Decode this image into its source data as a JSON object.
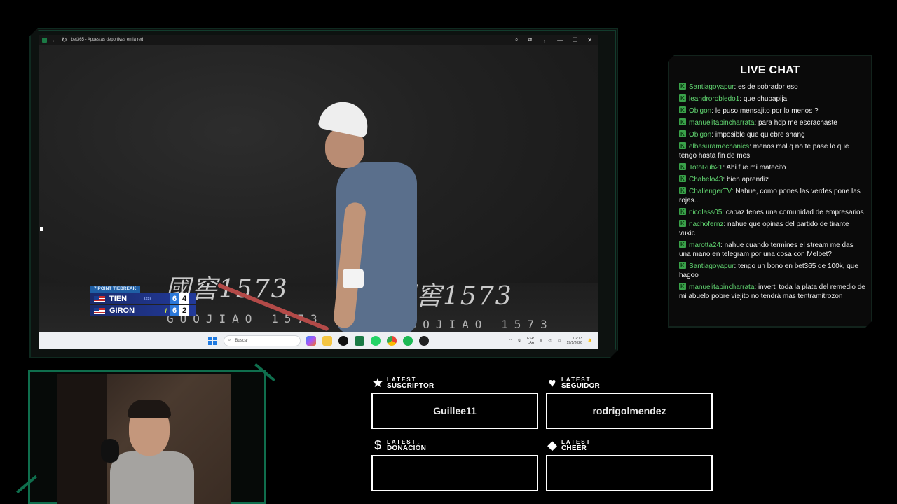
{
  "browser": {
    "title": "bet365 - Apuestas deportivas en la red"
  },
  "video": {
    "sponsor_text": "1573",
    "sponsor_prefix": "國窖",
    "sponsor_sub": "GUOJIAO 1573",
    "scoreboard": {
      "header": "7 POINT TIEBREAK",
      "players": [
        {
          "name": "TIEN",
          "rank": "(25)",
          "set": "6",
          "game": "4",
          "serving": ""
        },
        {
          "name": "GIRON",
          "rank": "",
          "set": "6",
          "game": "2",
          "serving": "/"
        }
      ]
    }
  },
  "taskbar": {
    "search_placeholder": "Buscar",
    "lang_top": "ESP",
    "lang_bottom": "LAA",
    "time": "02:13",
    "date": "19/1/2026"
  },
  "chat": {
    "title": "LIVE CHAT",
    "messages": [
      {
        "user": "Santiagoyapur",
        "text": "es de sobrador eso"
      },
      {
        "user": "leandrorobledo1",
        "text": "que chupapija"
      },
      {
        "user": "Obigon",
        "text": "le puso mensajito por lo menos ?"
      },
      {
        "user": "manuelitapincharrata",
        "text": "para hdp me escrachaste"
      },
      {
        "user": "Obigon",
        "text": "imposible que quiebre shang"
      },
      {
        "user": "elbasuramechanics",
        "text": "menos mal q no te pase lo que tengo hasta fin de mes"
      },
      {
        "user": "TotoRub21",
        "text": "Ahi fue mi matecito"
      },
      {
        "user": "Chabelo43",
        "text": "bien aprendiz"
      },
      {
        "user": "ChallengerTV",
        "text": "Nahue, como pones las verdes pone las rojas..."
      },
      {
        "user": "nicolass05",
        "text": "capaz tenes una comunidad de empresarios"
      },
      {
        "user": "nachofernz",
        "text": "nahue que opinas del partido de tirante vukic"
      },
      {
        "user": "marotta24",
        "text": "nahue cuando termines el stream me das una mano en telegram por una cosa con Melbet?"
      },
      {
        "user": "Santiagoyapur",
        "text": "tengo un bono en bet365 de 100k, que hagoo"
      },
      {
        "user": "manuelitapincharrata",
        "text": "inverti toda la plata del remedio de mi abuelo pobre viejito no tendrá mas tentramitrozon"
      }
    ]
  },
  "latest": {
    "suscriptor": {
      "top": "LATEST",
      "label": "SUSCRIPTOR",
      "value": "Guillee11",
      "icon": "star-icon"
    },
    "seguidor": {
      "top": "LATEST",
      "label": "SEGUIDOR",
      "value": "rodrigolmendez",
      "icon": "heart-icon"
    },
    "donacion": {
      "top": "LATEST",
      "label": "DONACIÓN",
      "value": "",
      "icon": "dollar-icon"
    },
    "cheer": {
      "top": "LATEST",
      "label": "CHEER",
      "value": "",
      "icon": "diamond-icon"
    }
  },
  "colors": {
    "accent_green": "#0f6e4d",
    "chat_user": "#62d872",
    "score_blue": "#2a78d8"
  }
}
